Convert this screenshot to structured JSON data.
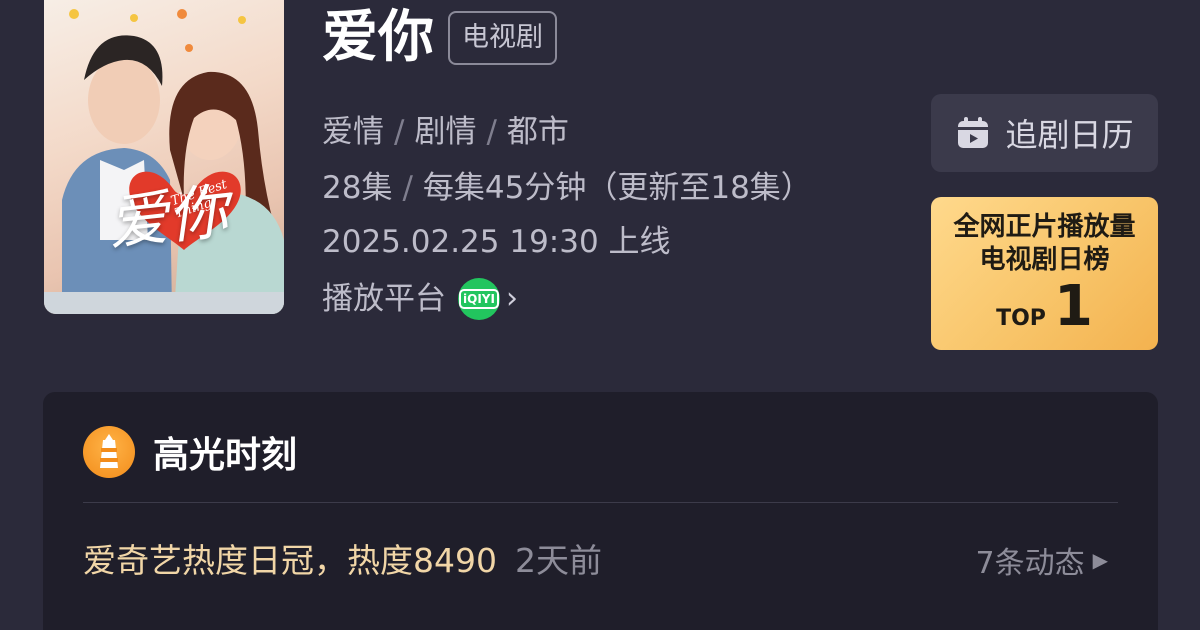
{
  "poster": {
    "title_cn": "爱你",
    "title_en": "The Best Thing"
  },
  "show": {
    "title": "爱你",
    "type_badge": "电视剧",
    "genres": [
      "爱情",
      "剧情",
      "都市"
    ],
    "separator": "/",
    "episodes": "28集",
    "duration": "每集45分钟（更新至18集）",
    "release": "2025.02.25 19:30 上线",
    "platform_label": "播放平台",
    "platform_logo_text": "iQIYI"
  },
  "calendar": {
    "label": "追剧日历",
    "icon": "calendar-icon"
  },
  "ranking": {
    "line1": "全网正片播放量",
    "line2": "电视剧日榜",
    "top_label": "TOP",
    "rank": "1"
  },
  "highlights": {
    "title": "高光时刻",
    "icon": "lighthouse-icon",
    "item": {
      "text": "爱奇艺热度日冠，热度8490",
      "time": "2天前"
    },
    "more_label": "7条动态"
  },
  "colors": {
    "background": "#2b2a3a",
    "card": "#1f1e2a",
    "gold_text": "#f1d6a7",
    "rank_card": "#f8c56a",
    "iqiyi_green": "#22c55e"
  }
}
